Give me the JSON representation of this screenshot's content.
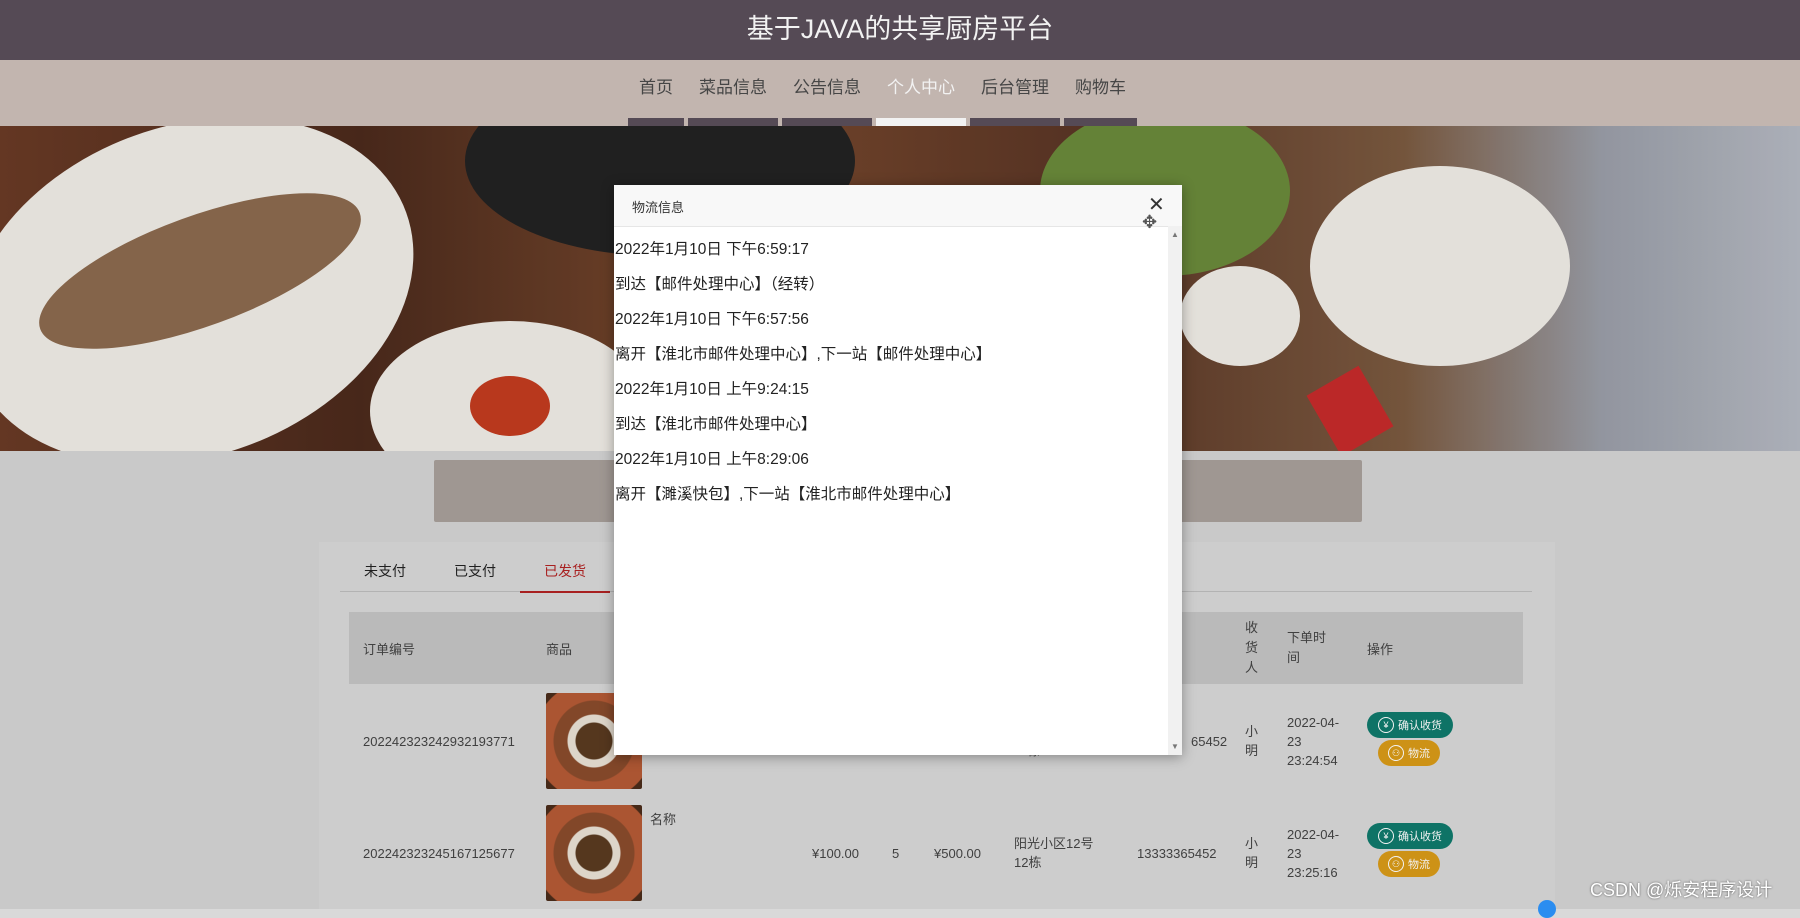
{
  "site": {
    "title": "基于JAVA的共享厨房平台"
  },
  "nav": {
    "items": [
      {
        "label": "首页"
      },
      {
        "label": "菜品信息"
      },
      {
        "label": "公告信息"
      },
      {
        "label": "个人中心"
      },
      {
        "label": "后台管理"
      },
      {
        "label": "购物车"
      }
    ],
    "active": "个人中心"
  },
  "orders": {
    "tabs": [
      {
        "label": "未支付"
      },
      {
        "label": "已支付"
      },
      {
        "label": "已发货"
      }
    ],
    "active_tab": "已发货",
    "headers": {
      "order_no": "订单编号",
      "product": "商品",
      "receiver": "收货人",
      "order_time": "下单时间",
      "actions": "操作"
    },
    "rows": [
      {
        "order_no": "20224232324293219377​1",
        "name": "",
        "unit_price": "",
        "qty": "",
        "total": "",
        "address": "12栋",
        "phone": "65452",
        "receiver": "小明",
        "time": "2022-04-23 23:24:54"
      },
      {
        "order_no": "20224232324516712567​7",
        "name": "名称",
        "unit_price": "¥100.00",
        "qty": "5",
        "total": "¥500.00",
        "address": "阳光小区12号12栋",
        "phone": "13333365452",
        "receiver": "小明",
        "time": "2022-04-23 23:25:16"
      }
    ],
    "confirm_label": "确认收货",
    "logistics_label": "物流"
  },
  "modal": {
    "title": "物流信息",
    "lines": [
      "2022年1月10日 下午6:59:17",
      "到达【邮件处理中心】（经转）",
      "2022年1月10日 下午6:57:56",
      "离开【淮北市邮件处理中心】,下一站【邮件处理中心】",
      "2022年1月10日 上午9:24:15",
      "到达【淮北市邮件处理中心】",
      "2022年1月10日 上午8:29:06",
      "离开【濉溪快包】,下一站【淮北市邮件处理中心】"
    ]
  },
  "watermark": "CSDN @烁安程序设计",
  "icons": {
    "close": "close-icon",
    "move": "move-cursor-icon",
    "yen": "yen-icon",
    "user": "user-icon"
  }
}
